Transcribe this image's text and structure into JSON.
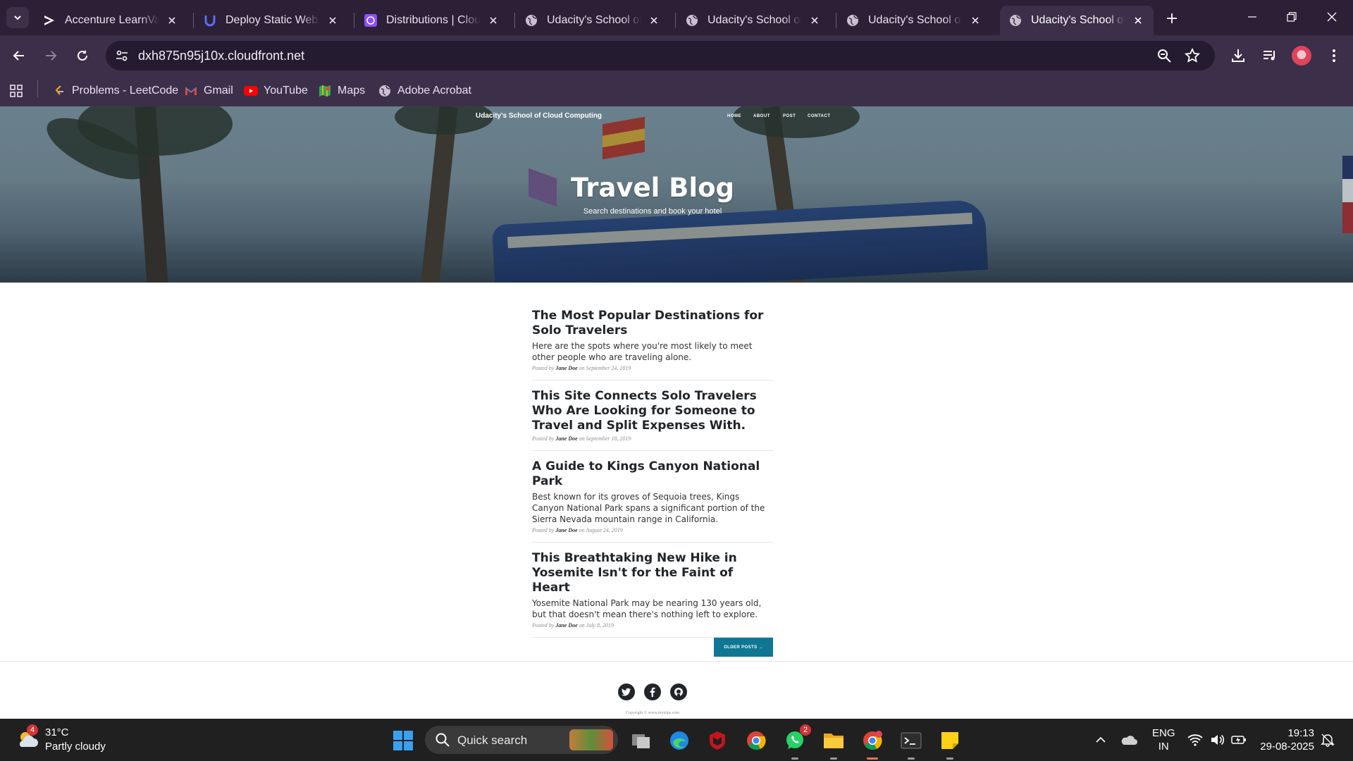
{
  "browser": {
    "tabs": [
      {
        "title": "Accenture LearnVantage",
        "icon": "accenture-icon"
      },
      {
        "title": "Deploy Static Website",
        "icon": "udacity-icon"
      },
      {
        "title": "Distributions | CloudFront",
        "icon": "cloudfront-icon"
      },
      {
        "title": "Udacity's School of Cloud",
        "icon": "globe-icon"
      },
      {
        "title": "Udacity's School of Cloud",
        "icon": "globe-icon"
      },
      {
        "title": "Udacity's School of Cloud",
        "icon": "globe-icon"
      },
      {
        "title": "Udacity's School of Cloud",
        "icon": "globe-icon",
        "active": true
      }
    ],
    "url": "dxh875n95j10x.cloudfront.net",
    "bookmarks": [
      {
        "label": "Problems - LeetCode",
        "icon": "leetcode-icon"
      },
      {
        "label": "Gmail",
        "icon": "gmail-icon"
      },
      {
        "label": "YouTube",
        "icon": "youtube-icon"
      },
      {
        "label": "Maps",
        "icon": "maps-icon"
      },
      {
        "label": "Adobe Acrobat",
        "icon": "globe-icon"
      }
    ]
  },
  "site": {
    "brand": "Udacity's School of Cloud Computing",
    "nav": [
      "HOME",
      "ABOUT",
      "POST",
      "CONTACT"
    ],
    "hero_title": "Travel Blog",
    "hero_subtitle": "Search destinations and book your hotel",
    "posts": [
      {
        "title": "The Most Popular Destinations for Solo Travelers",
        "summary": "Here are the spots where you're most likely to meet other people who are traveling alone.",
        "meta_prefix": "Posted by",
        "author": "Jane Doe",
        "meta_suffix": "on September 24, 2019"
      },
      {
        "title": "This Site Connects Solo Travelers Who Are Looking for Someone to Travel and Split Expenses With.",
        "summary": "",
        "meta_prefix": "Posted by",
        "author": "Jane Doe",
        "meta_suffix": "on September 18, 2019"
      },
      {
        "title": "A Guide to Kings Canyon National Park",
        "summary": "Best known for its groves of Sequoia trees, Kings Canyon National Park spans a significant portion of the Sierra Nevada mountain range in California.",
        "meta_prefix": "Posted by",
        "author": "Jane Doe",
        "meta_suffix": "on August 24, 2019"
      },
      {
        "title": "This Breathtaking New Hike in Yosemite Isn't for the Faint of Heart",
        "summary": "Yosemite National Park may be nearing 130 years old, but that doesn't mean there's nothing left to explore.",
        "meta_prefix": "Posted by",
        "author": "Jane Doe",
        "meta_suffix": "on July 8, 2019"
      }
    ],
    "older_posts": "OLDER POSTS →",
    "social": [
      "twitter-icon",
      "facebook-icon",
      "github-icon"
    ],
    "copyright": "Copyright © www.mytrips.com"
  },
  "taskbar": {
    "weather_badge": "4",
    "temperature": "31°C",
    "condition": "Partly cloudy",
    "search_placeholder": "Quick search",
    "whatsapp_badge": "2",
    "lang_line1": "ENG",
    "lang_line2": "IN",
    "time": "19:13",
    "date": "29-08-2025"
  },
  "colors": {
    "browser_frame": "#2b2036",
    "browser_toolbar": "#3c2f4a",
    "older_button": "#0f7794",
    "taskbar": "#202020"
  }
}
